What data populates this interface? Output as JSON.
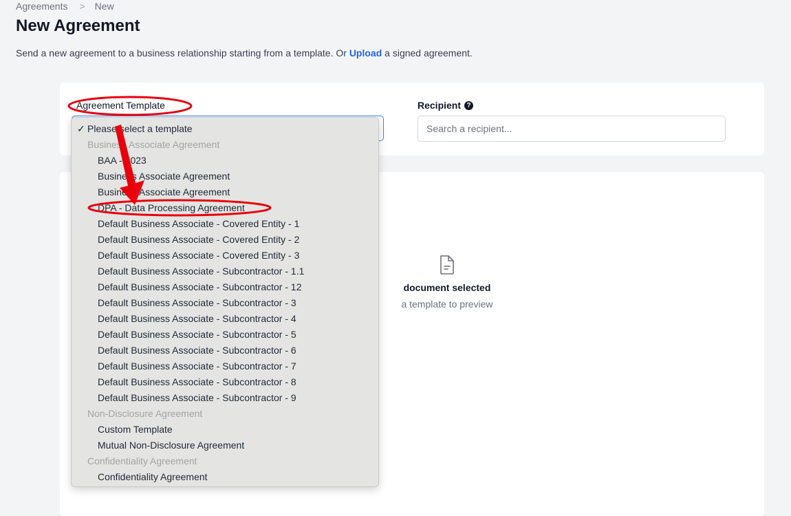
{
  "breadcrumb": {
    "items": [
      "Agreements",
      "New"
    ],
    "separator": ">"
  },
  "page": {
    "title": "New Agreement",
    "subtitle_before": "Send a new agreement to a business relationship starting from a template. Or ",
    "subtitle_link": "Upload",
    "subtitle_after": " a signed agreement."
  },
  "form": {
    "template_label": "Agreement Template",
    "recipient_label": "Recipient",
    "recipient_help": "?",
    "recipient_placeholder": "Search a recipient..."
  },
  "preview": {
    "title": "document selected",
    "subtitle": "a template to preview"
  },
  "dropdown": {
    "selected": {
      "check": "✓",
      "label": "Please select a template"
    },
    "groups": [
      {
        "label": "Business Associate Agreement",
        "options": [
          "BAA - 2023",
          "Business Associate Agreement",
          "Business Associate Agreement",
          "DPA - Data Processing Agreement",
          "Default Business Associate - Covered Entity - 1",
          "Default Business Associate - Covered Entity - 2",
          "Default Business Associate - Covered Entity - 3",
          "Default Business Associate - Subcontractor - 1.1",
          "Default Business Associate - Subcontractor - 12",
          "Default Business Associate - Subcontractor - 3",
          "Default Business Associate - Subcontractor - 4",
          "Default Business Associate - Subcontractor - 5",
          "Default Business Associate - Subcontractor - 6",
          "Default Business Associate - Subcontractor - 7",
          "Default Business Associate - Subcontractor - 8",
          "Default Business Associate - Subcontractor - 9"
        ]
      },
      {
        "label": "Non-Disclosure Agreement",
        "options": [
          "Custom Template",
          "Mutual Non-Disclosure Agreement"
        ]
      },
      {
        "label": "Confidentiality Agreement",
        "options": [
          "Confidentiality Agreement"
        ]
      }
    ]
  },
  "colors": {
    "accent": "#2563eb",
    "annotation": "#e8000d",
    "focus": "#3b82f6"
  }
}
